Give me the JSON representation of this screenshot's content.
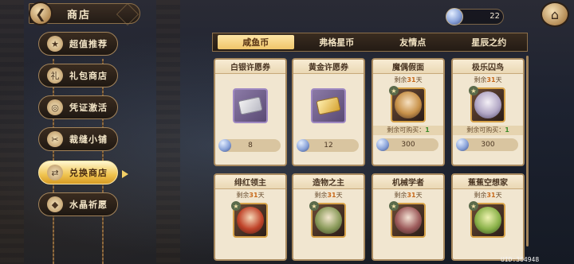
{
  "header": {
    "title": "商店"
  },
  "currency": {
    "amount": "22"
  },
  "sidebar": {
    "items": [
      {
        "label": "超值推荐",
        "icon": "★"
      },
      {
        "label": "礼包商店",
        "icon": "礼"
      },
      {
        "label": "凭证激活",
        "icon": "◎"
      },
      {
        "label": "裁缝小铺",
        "icon": "✂"
      },
      {
        "label": "兑换商店",
        "icon": "⇄",
        "active": true
      },
      {
        "label": "水晶祈愿",
        "icon": "◆"
      }
    ]
  },
  "tabs": [
    {
      "label": "咸鱼币",
      "active": true
    },
    {
      "label": "弗格星币"
    },
    {
      "label": "友情点"
    },
    {
      "label": "星辰之约"
    }
  ],
  "cards": [
    {
      "title": "白银许愿券",
      "type": "silver-ticket",
      "price": "8"
    },
    {
      "title": "黄金许愿券",
      "type": "gold-ticket",
      "price": "12"
    },
    {
      "title": "魔偶假面",
      "type": "portrait",
      "remain_prefix": "剩余",
      "remain_days": "31",
      "remain_suffix": "天",
      "limit_label": "剩余可购买：",
      "limit_value": "1",
      "price": "300"
    },
    {
      "title": "极乐囚鸟",
      "type": "portrait",
      "remain_prefix": "剩余",
      "remain_days": "31",
      "remain_suffix": "天",
      "limit_label": "剩余可购买：",
      "limit_value": "1",
      "price": "300"
    },
    {
      "title": "绯红领主",
      "type": "portrait",
      "remain_prefix": "剩余",
      "remain_days": "31",
      "remain_suffix": "天"
    },
    {
      "title": "造物之主",
      "type": "portrait",
      "remain_prefix": "剩余",
      "remain_days": "31",
      "remain_suffix": "天"
    },
    {
      "title": "机械学者",
      "type": "portrait",
      "remain_prefix": "剩余",
      "remain_days": "31",
      "remain_suffix": "天"
    },
    {
      "title": "蕉蕉空想家",
      "type": "portrait",
      "remain_prefix": "剩余",
      "remain_days": "31",
      "remain_suffix": "天"
    }
  ],
  "footer": {
    "uid": "UID:304948"
  }
}
